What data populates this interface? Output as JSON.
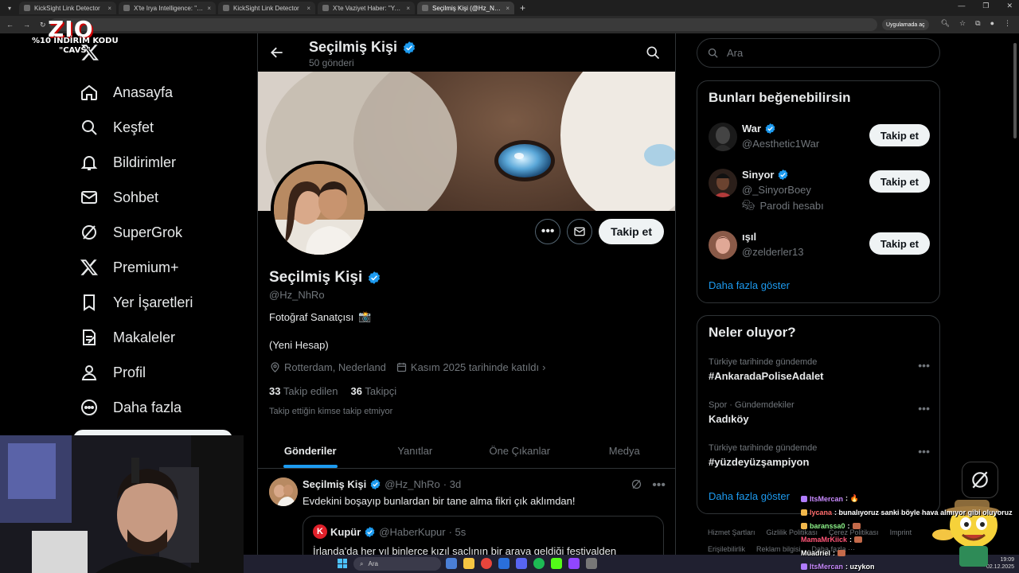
{
  "browser": {
    "tabs": [
      {
        "title": "KickSight Link Detector",
        "active": false
      },
      {
        "title": "X'te Irya Intelligence: \"🔴 Yayı",
        "active": false
      },
      {
        "title": "KickSight Link Detector",
        "active": false
      },
      {
        "title": "X'te Vaziyet Haber: \"Yeni evlenen",
        "active": false
      },
      {
        "title": "Seçilmiş Kişi (@Hz_NhRo) / X",
        "active": true
      }
    ],
    "apps_chip": "Uygulamada aç"
  },
  "overlay": {
    "logo": "ZIO",
    "promo": "%10 İNDİRİM KODU",
    "code": "\"CAVS\""
  },
  "nav": {
    "items": [
      {
        "label": "Anasayfa",
        "icon": "home-icon"
      },
      {
        "label": "Keşfet",
        "icon": "search-icon"
      },
      {
        "label": "Bildirimler",
        "icon": "bell-icon"
      },
      {
        "label": "Sohbet",
        "icon": "mail-icon"
      },
      {
        "label": "SuperGrok",
        "icon": "grok-icon"
      },
      {
        "label": "Premium+",
        "icon": "x-icon"
      },
      {
        "label": "Yer İşaretleri",
        "icon": "bookmark-icon"
      },
      {
        "label": "Makaleler",
        "icon": "article-icon"
      },
      {
        "label": "Profil",
        "icon": "person-icon"
      },
      {
        "label": "Daha fazla",
        "icon": "more-icon"
      }
    ]
  },
  "header": {
    "name": "Seçilmiş Kişi",
    "post_count": "50 gönderi"
  },
  "profile": {
    "name": "Seçilmiş Kişi",
    "handle": "@Hz_NhRo",
    "bio_line1": "Fotoğraf Sanatçısı",
    "bio_emoji": "📸",
    "bio_line2": "(Yeni Hesap)",
    "location": "Rotterdam, Nederland",
    "joined": "Kasım 2025 tarihinde katıldı",
    "following_count": "33",
    "following_label": "Takip edilen",
    "followers_count": "36",
    "followers_label": "Takipçi",
    "mutual_note": "Takip ettiğin kimse takip etmiyor",
    "follow_label": "Takip et"
  },
  "profile_tabs": [
    "Gönderiler",
    "Yanıtlar",
    "Öne Çıkanlar",
    "Medya"
  ],
  "post": {
    "name": "Seçilmiş Kişi",
    "handle": "@Hz_NhRo",
    "time": "· 3d",
    "text": "Evdekini boşayıp bunlardan bir tane alma fikri çık aklımdan!",
    "quote": {
      "logo": "K",
      "name": "Kupür",
      "handle": "@HaberKupur",
      "time": "· 5s",
      "text": "İrlanda'da her yıl binlerce kızıl saçlının bir araya geldiği festivalden"
    }
  },
  "search": {
    "placeholder": "Ara"
  },
  "suggestions": {
    "title": "Bunları beğenebilirsin",
    "items": [
      {
        "name": "War",
        "handle": "@Aesthetic1War",
        "verified": true,
        "extra": ""
      },
      {
        "name": "Sinyor",
        "handle": "@_SinyorBoey",
        "verified": true,
        "extra": "Parodi hesabı"
      },
      {
        "name": "ışıl",
        "handle": "@zelderler13",
        "verified": false,
        "extra": ""
      }
    ],
    "follow_label": "Takip et",
    "show_more": "Daha fazla göster"
  },
  "trends": {
    "title": "Neler oluyor?",
    "items": [
      {
        "category": "Türkiye tarihinde gündemde",
        "name": "#AnkaradaPoliseAdalet"
      },
      {
        "category": "Spor · Gündemdekiler",
        "name": "Kadıköy"
      },
      {
        "category": "Türkiye tarihinde gündemde",
        "name": "#yüzdeyüzşampiyon"
      }
    ],
    "show_more": "Daha fazla göster"
  },
  "footer": [
    "Hizmet Şartları",
    "Gizlilik Politikası",
    "Çerez Politikası",
    "Imprint",
    "Erişilebilirlik",
    "Reklam bilgisi",
    "Daha fazla ···"
  ],
  "chat": [
    {
      "user": "ItsMercan",
      "user_color": "#c98bff",
      "msg": ": 🔥"
    },
    {
      "user": "lycana",
      "user_color": "#ff6b6b",
      "msg": ": bunalıyoruz sanki böyle hava almıyor gibi oluyoruz"
    },
    {
      "user": "baranssa0",
      "user_color": "#8ef58a",
      "msg": ":"
    },
    {
      "user": "MamaMrKiick",
      "user_color": "#ff5577",
      "msg": ":"
    },
    {
      "user": "Müadriel",
      "user_color": "#ffffff",
      "msg": ":"
    },
    {
      "user": "ItsMercan",
      "user_color": "#c98bff",
      "msg": ": uzykon"
    }
  ],
  "taskbar": {
    "search": "Ara",
    "time": "19:09",
    "date": "02.12.2025"
  },
  "colors": {
    "accent": "#1d9bf0",
    "background": "#000000",
    "border": "#2f3336",
    "muted": "#71767b"
  }
}
